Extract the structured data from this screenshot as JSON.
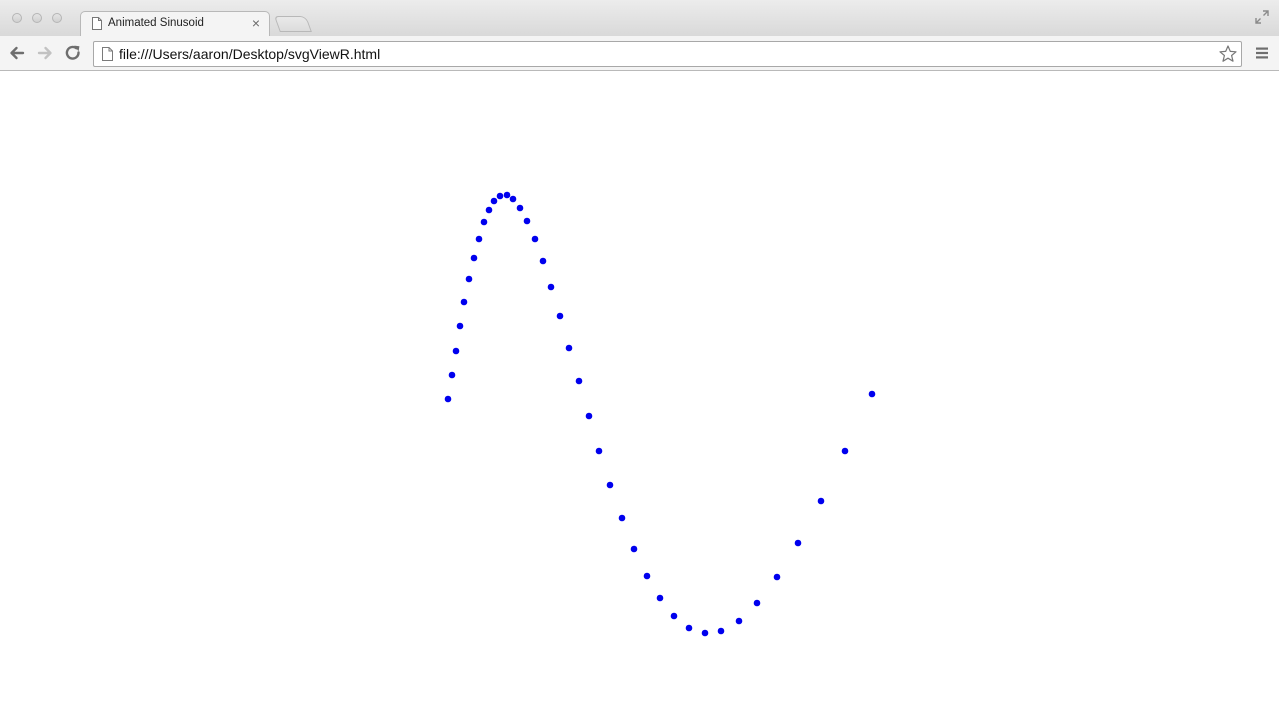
{
  "window": {
    "tab": {
      "title": "Animated Sinusoid"
    },
    "address_bar": {
      "url": "file:///Users/aaron/Desktop/svgViewR.html"
    }
  },
  "chart_data": {
    "type": "scatter",
    "title": "",
    "xlabel": "",
    "ylabel": "",
    "grid": false,
    "point_color": "#0000ee",
    "series": [
      {
        "points": [
          [
            448,
            399
          ],
          [
            452,
            375
          ],
          [
            456,
            351
          ],
          [
            460,
            326
          ],
          [
            464,
            302
          ],
          [
            469,
            279
          ],
          [
            474,
            258
          ],
          [
            479,
            239
          ],
          [
            484,
            222
          ],
          [
            489,
            210
          ],
          [
            494,
            201
          ],
          [
            500,
            196
          ],
          [
            507,
            195
          ],
          [
            513,
            199
          ],
          [
            520,
            208
          ],
          [
            527,
            221
          ],
          [
            535,
            239
          ],
          [
            543,
            261
          ],
          [
            551,
            287
          ],
          [
            560,
            316
          ],
          [
            569,
            348
          ],
          [
            579,
            381
          ],
          [
            589,
            416
          ],
          [
            599,
            451
          ],
          [
            610,
            485
          ],
          [
            622,
            518
          ],
          [
            634,
            549
          ],
          [
            647,
            576
          ],
          [
            660,
            598
          ],
          [
            674,
            616
          ],
          [
            689,
            628
          ],
          [
            705,
            633
          ],
          [
            721,
            631
          ],
          [
            739,
            621
          ],
          [
            757,
            603
          ],
          [
            777,
            577
          ],
          [
            798,
            543
          ],
          [
            821,
            501
          ],
          [
            845,
            451
          ],
          [
            872,
            394
          ]
        ]
      }
    ]
  }
}
